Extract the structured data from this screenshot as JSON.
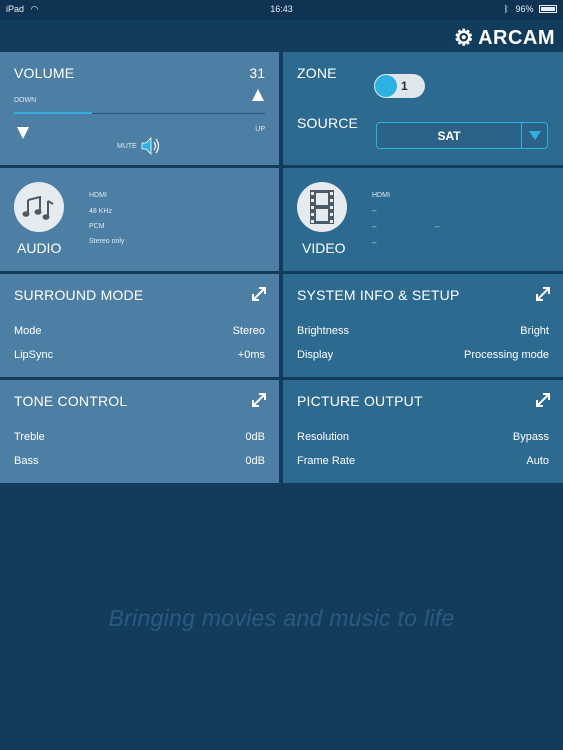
{
  "status_bar": {
    "carrier": "iPad",
    "time": "16:43",
    "battery": "96%"
  },
  "brand": {
    "logo_text": "ARCAM"
  },
  "volume": {
    "title": "VOLUME",
    "value": "31",
    "down_label": "DOWN",
    "up_label": "UP",
    "mute_label": "MUTE",
    "level_fraction": 0.31
  },
  "zone": {
    "title": "ZONE",
    "toggle_value": "1",
    "source_title": "SOURCE",
    "source_value": "SAT"
  },
  "audio": {
    "title": "AUDIO",
    "lines": [
      "HDMI",
      "48 KHz",
      "PCM",
      "Stereo only"
    ]
  },
  "video": {
    "title": "VIDEO",
    "line1": "HDMI",
    "line2": "--",
    "line3a": "--",
    "line3b": "--",
    "line4": "--"
  },
  "surround": {
    "title": "SURROUND MODE",
    "rows": [
      {
        "label": "Mode",
        "value": "Stereo"
      },
      {
        "label": "LipSync",
        "value": "+0ms"
      }
    ]
  },
  "system": {
    "title": "SYSTEM INFO & SETUP",
    "rows": [
      {
        "label": "Brightness",
        "value": "Bright"
      },
      {
        "label": "Display",
        "value": "Processing mode"
      }
    ]
  },
  "tone": {
    "title": "TONE CONTROL",
    "rows": [
      {
        "label": "Treble",
        "value": "0dB"
      },
      {
        "label": "Bass",
        "value": "0dB"
      }
    ]
  },
  "picture": {
    "title": "PICTURE OUTPUT",
    "rows": [
      {
        "label": "Resolution",
        "value": "Bypass"
      },
      {
        "label": "Frame Rate",
        "value": "Auto"
      }
    ]
  },
  "tagline": "Bringing movies and music to life",
  "colors": {
    "accent": "#2ab3e0",
    "panel_light": "#4c7fa3",
    "panel_dark": "#2d6a90",
    "background": "#123c5c"
  }
}
